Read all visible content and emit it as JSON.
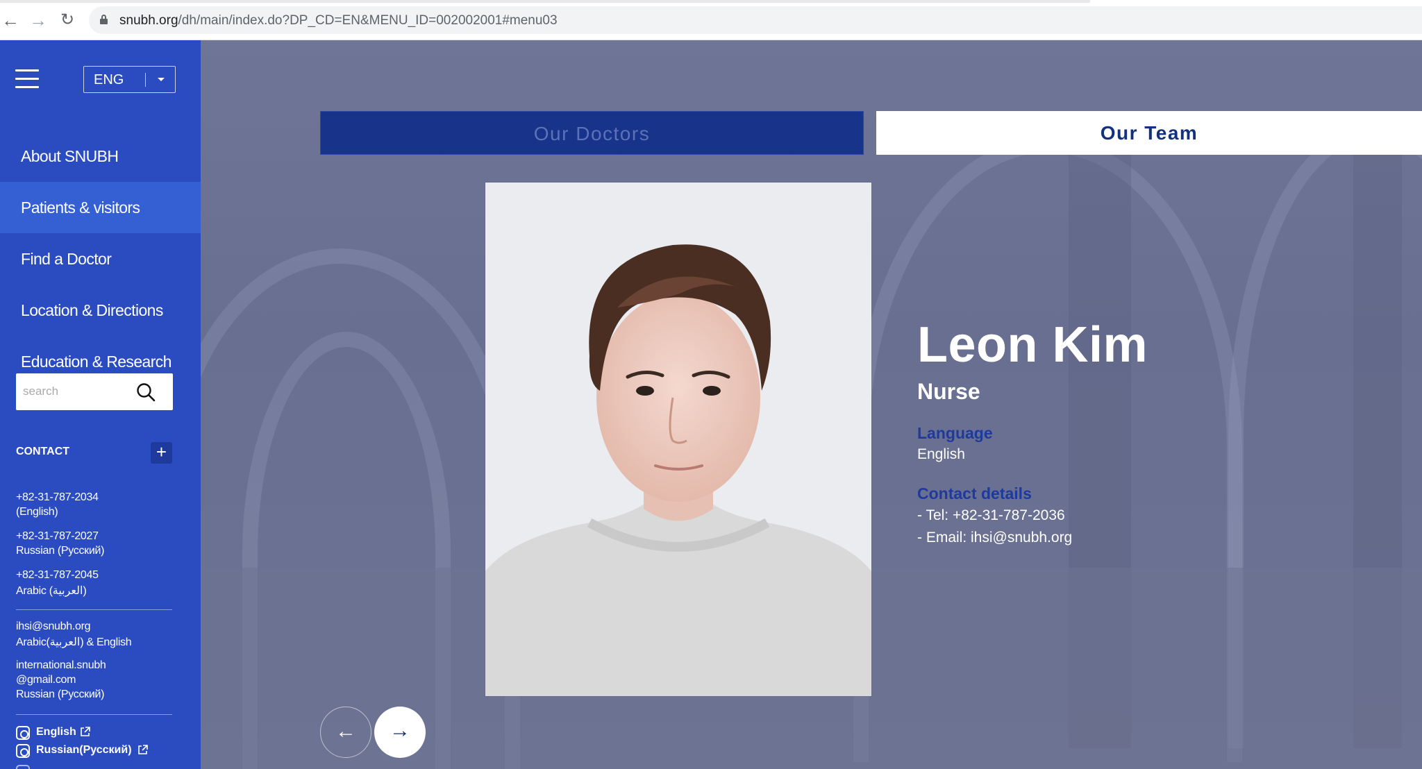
{
  "browser": {
    "url_domain": "snubh.org",
    "url_path": "/dh/main/index.do?DP_CD=EN&MENU_ID=002002001#menu03",
    "back_icon": "back-arrow-icon",
    "forward_icon": "forward-arrow-icon",
    "reload_icon": "reload-icon"
  },
  "sidebar": {
    "language": "ENG",
    "menu": [
      {
        "label": "About SNUBH",
        "active": false
      },
      {
        "label": "Patients & visitors",
        "active": true
      },
      {
        "label": "Find a Doctor",
        "active": false
      },
      {
        "label": "Location & Directions",
        "active": false
      },
      {
        "label": "Education & Research",
        "active": false
      }
    ],
    "search_placeholder": "search",
    "contact_title": "CONTACT",
    "contacts": [
      {
        "line1": "+82-31-787-2034",
        "line2": "(English)"
      },
      {
        "line1": "+82-31-787-2027",
        "line2": "Russian (Русский)"
      },
      {
        "line1": "+82-31-787-2045",
        "line2": "Arabic (العربية)"
      }
    ],
    "emails": [
      {
        "lines": [
          "ihsi@snubh.org",
          "Arabic(العربية) & English"
        ]
      },
      {
        "lines": [
          "international.snubh",
          "@gmail.com",
          "Russian (Русский)"
        ]
      }
    ],
    "socials": [
      {
        "label": "English"
      },
      {
        "label": "Russian(Русский)"
      }
    ]
  },
  "main": {
    "tabs": [
      {
        "label": "Our Doctors",
        "active": false
      },
      {
        "label": "Our Team",
        "active": true
      }
    ],
    "profile": {
      "name": "Leon Kim",
      "role": "Nurse",
      "language_label": "Language",
      "language_value": "English",
      "contact_label": "Contact details",
      "tel": "- Tel: +82-31-787-2036",
      "email": "- Email: ihsi@snubh.org"
    },
    "prev_arrow": "←",
    "next_arrow": "→"
  },
  "colors": {
    "sidebar_bg": "#2b4cc1",
    "sidebar_active": "#3560d4",
    "tab_inactive_bg": "#17348a",
    "accent_navy": "#13317f",
    "label_blue": "#1d3a9c"
  }
}
